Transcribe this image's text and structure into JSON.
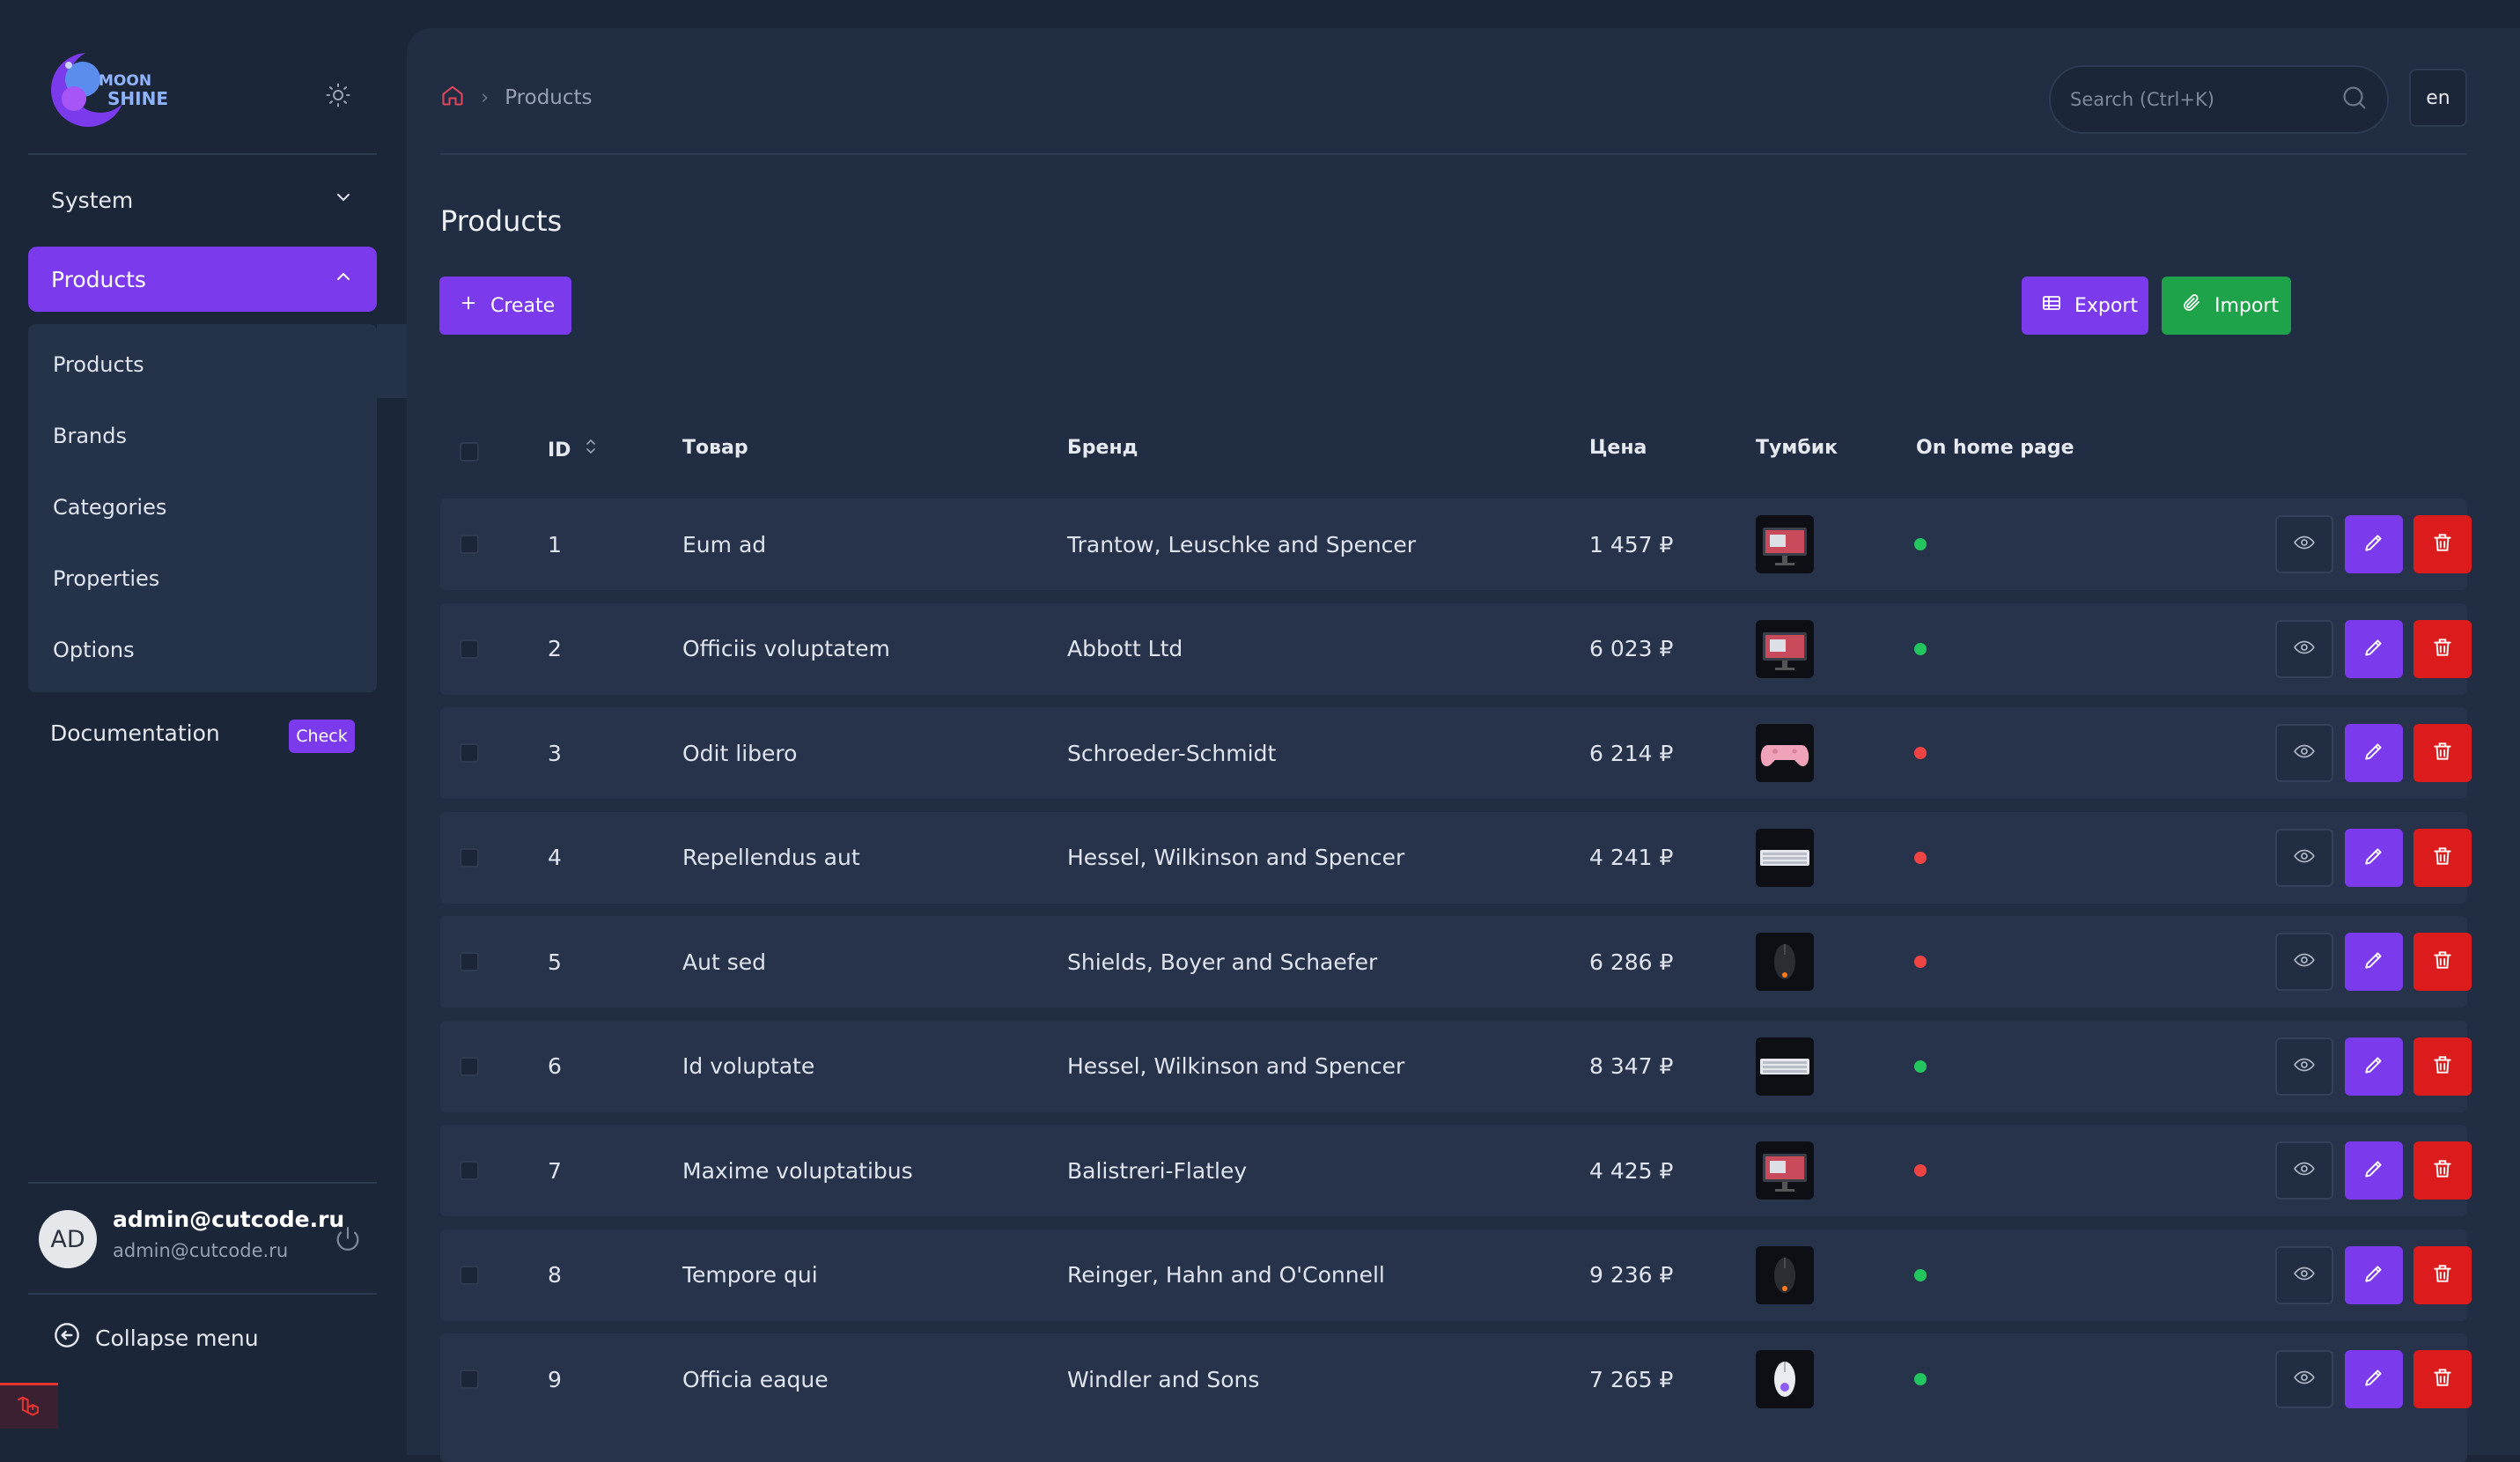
{
  "colors": {
    "accent": "#7c3aed",
    "success": "#1fa34a",
    "danger": "#dc1c1c",
    "dot_on": "#22c55e",
    "dot_off": "#ef4444"
  },
  "sidebar": {
    "logo_line1": "MOON",
    "logo_line2": "SHINE",
    "groups": [
      {
        "label": "System"
      },
      {
        "label": "Products"
      }
    ],
    "submenu": [
      {
        "label": "Products"
      },
      {
        "label": "Brands"
      },
      {
        "label": "Categories"
      },
      {
        "label": "Properties"
      },
      {
        "label": "Options"
      }
    ],
    "documentation": {
      "label": "Documentation",
      "badge": "Check"
    },
    "user": {
      "initials": "AD",
      "name": "admin@cutcode.ru",
      "email": "admin@cutcode.ru"
    },
    "collapse_label": "Collapse menu"
  },
  "header": {
    "breadcrumb": "Products",
    "search_placeholder": "Search (Ctrl+K)",
    "lang": "en"
  },
  "page": {
    "title": "Products",
    "create_label": "Create",
    "export_label": "Export",
    "import_label": "Import"
  },
  "table": {
    "headers": {
      "id": "ID",
      "product": "Товар",
      "brand": "Бренд",
      "price": "Цена",
      "thumb": "Тумбик",
      "home": "On home page"
    },
    "rows": [
      {
        "id": "1",
        "product": "Eum ad",
        "brand": "Trantow, Leuschke and Spencer",
        "price": "1 457 ₽",
        "thumb": "monitor",
        "home": true
      },
      {
        "id": "2",
        "product": "Officiis voluptatem",
        "brand": "Abbott Ltd",
        "price": "6 023 ₽",
        "thumb": "monitor",
        "home": true
      },
      {
        "id": "3",
        "product": "Odit libero",
        "brand": "Schroeder-Schmidt",
        "price": "6 214 ₽",
        "thumb": "gamepad",
        "home": false
      },
      {
        "id": "4",
        "product": "Repellendus aut",
        "brand": "Hessel, Wilkinson and Spencer",
        "price": "4 241 ₽",
        "thumb": "keyboard",
        "home": false
      },
      {
        "id": "5",
        "product": "Aut sed",
        "brand": "Shields, Boyer and Schaefer",
        "price": "6 286 ₽",
        "thumb": "mouse",
        "home": false
      },
      {
        "id": "6",
        "product": "Id voluptate",
        "brand": "Hessel, Wilkinson and Spencer",
        "price": "8 347 ₽",
        "thumb": "keyboard",
        "home": true
      },
      {
        "id": "7",
        "product": "Maxime voluptatibus",
        "brand": "Balistreri-Flatley",
        "price": "4 425 ₽",
        "thumb": "monitor",
        "home": false
      },
      {
        "id": "8",
        "product": "Tempore qui",
        "brand": "Reinger, Hahn and O'Connell",
        "price": "9 236 ₽",
        "thumb": "mouse",
        "home": true
      },
      {
        "id": "9",
        "product": "Officia eaque",
        "brand": "Windler and Sons",
        "price": "7 265 ₽",
        "thumb": "mouse-white",
        "home": true
      }
    ]
  }
}
